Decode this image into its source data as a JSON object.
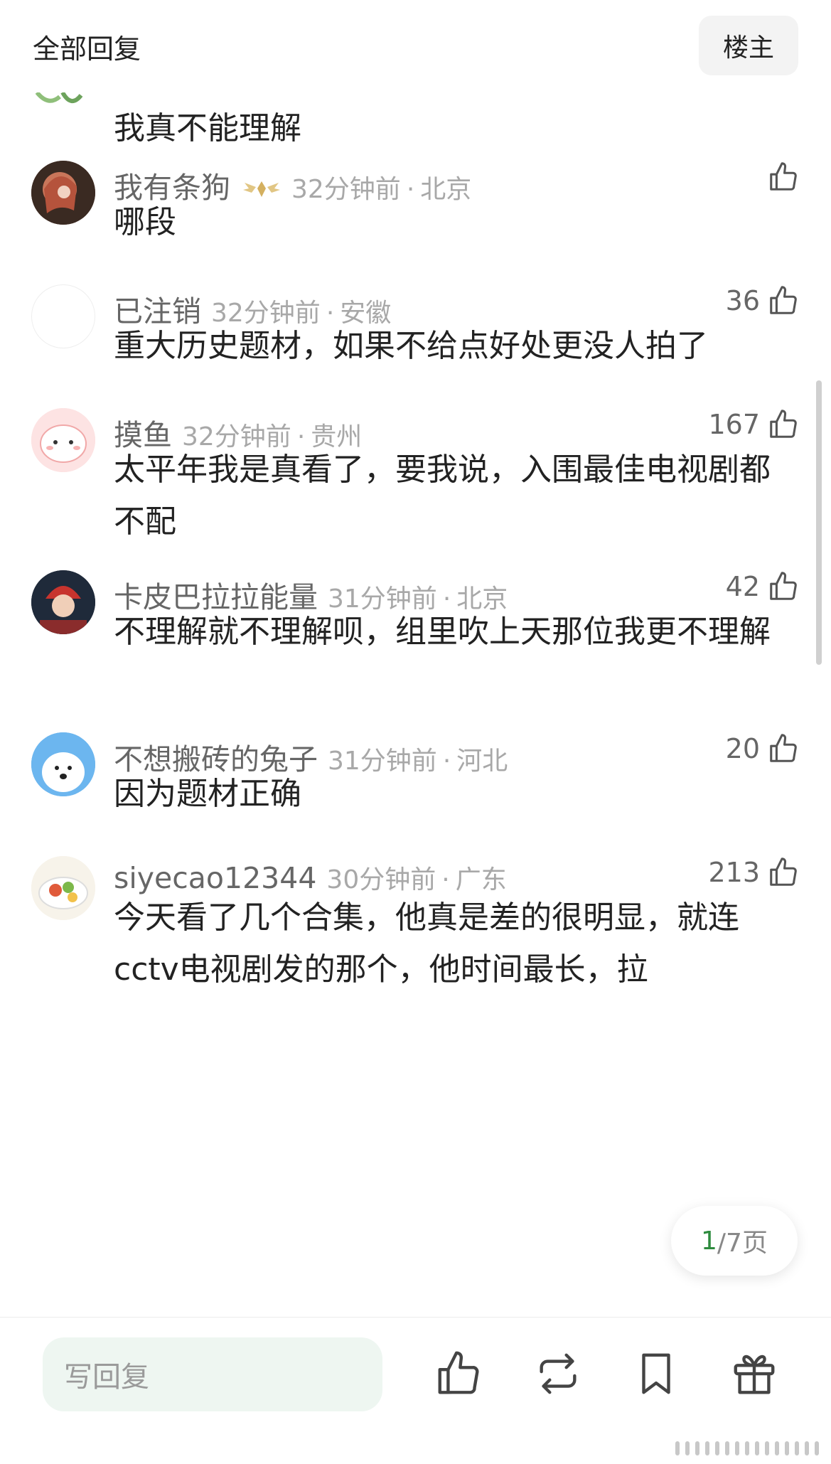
{
  "header": {
    "title": "全部回复",
    "op_button": "楼主"
  },
  "partial_comment": {
    "text": "我真不能理解"
  },
  "comments": [
    {
      "name": "我有条狗",
      "time": "32分钟前",
      "location": "北京",
      "likes": "",
      "text": "哪段",
      "has_badge": true
    },
    {
      "name": "已注销",
      "time": "32分钟前",
      "location": "安徽",
      "likes": "36",
      "text": "重大历史题材，如果不给点好处更没人拍了"
    },
    {
      "name": "摸鱼",
      "time": "32分钟前",
      "location": "贵州",
      "likes": "167",
      "text": "太平年我是真看了，要我说，入围最佳电视剧都不配"
    },
    {
      "name": "卡皮巴拉拉能量",
      "time": "31分钟前",
      "location": "北京",
      "likes": "42",
      "text": "不理解就不理解呗，组里吹上天那位我更不理解"
    },
    {
      "name": "不想搬砖的兔子",
      "time": "31分钟前",
      "location": "河北",
      "likes": "20",
      "text": "因为题材正确"
    },
    {
      "name": "siyecao12344",
      "time": "30分钟前",
      "location": "广东",
      "likes": "213",
      "text": "今天看了几个合集，他真是差的很明显，就连cctv电视剧发的那个，他时间最长，拉"
    }
  ],
  "pager": {
    "current": "1",
    "sep_total": "/7页"
  },
  "bottom_bar": {
    "reply_placeholder": "写回复"
  },
  "icons": [
    "thumb-up-icon",
    "repost-icon",
    "bookmark-icon",
    "gift-icon"
  ],
  "colors": {
    "accent": "#2e8b3e",
    "meta": "#a8a8a8",
    "input_bg": "#eef6f1"
  }
}
